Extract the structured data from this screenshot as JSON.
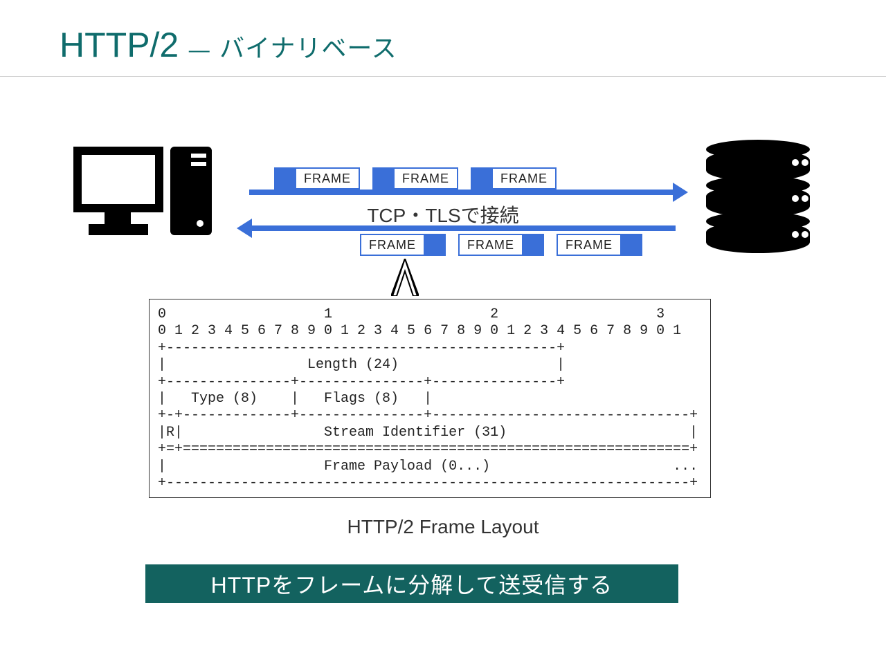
{
  "title": {
    "main": "HTTP/2",
    "separator": "―",
    "subtitle": "バイナリベース"
  },
  "diagram": {
    "frame_label": "FRAME",
    "connection_label": "TCP・TLSで接続",
    "top_frames": [
      "FRAME",
      "FRAME",
      "FRAME"
    ],
    "bottom_frames": [
      "FRAME",
      "FRAME",
      "FRAME"
    ]
  },
  "frame_layout": {
    "caption": "HTTP/2 Frame Layout",
    "ascii": "0                   1                   2                   3\n0 1 2 3 4 5 6 7 8 9 0 1 2 3 4 5 6 7 8 9 0 1 2 3 4 5 6 7 8 9 0 1\n+-----------------------------------------------+\n|                 Length (24)                   |\n+---------------+---------------+---------------+\n|   Type (8)    |   Flags (8)   |\n+-+-------------+---------------+-------------------------------+\n|R|                 Stream Identifier (31)                      |\n+=+=============================================================+\n|                   Frame Payload (0...)                      ...\n+---------------------------------------------------------------+",
    "fields": {
      "length_bits": 24,
      "type_bits": 8,
      "flags_bits": 8,
      "reserved_bits": 1,
      "stream_identifier_bits": 31,
      "payload": "0..."
    }
  },
  "banner": "HTTPをフレームに分解して送受信する",
  "colors": {
    "accent": "#3a6fd8",
    "title": "#0f6c6c",
    "banner_bg": "#13625f"
  }
}
